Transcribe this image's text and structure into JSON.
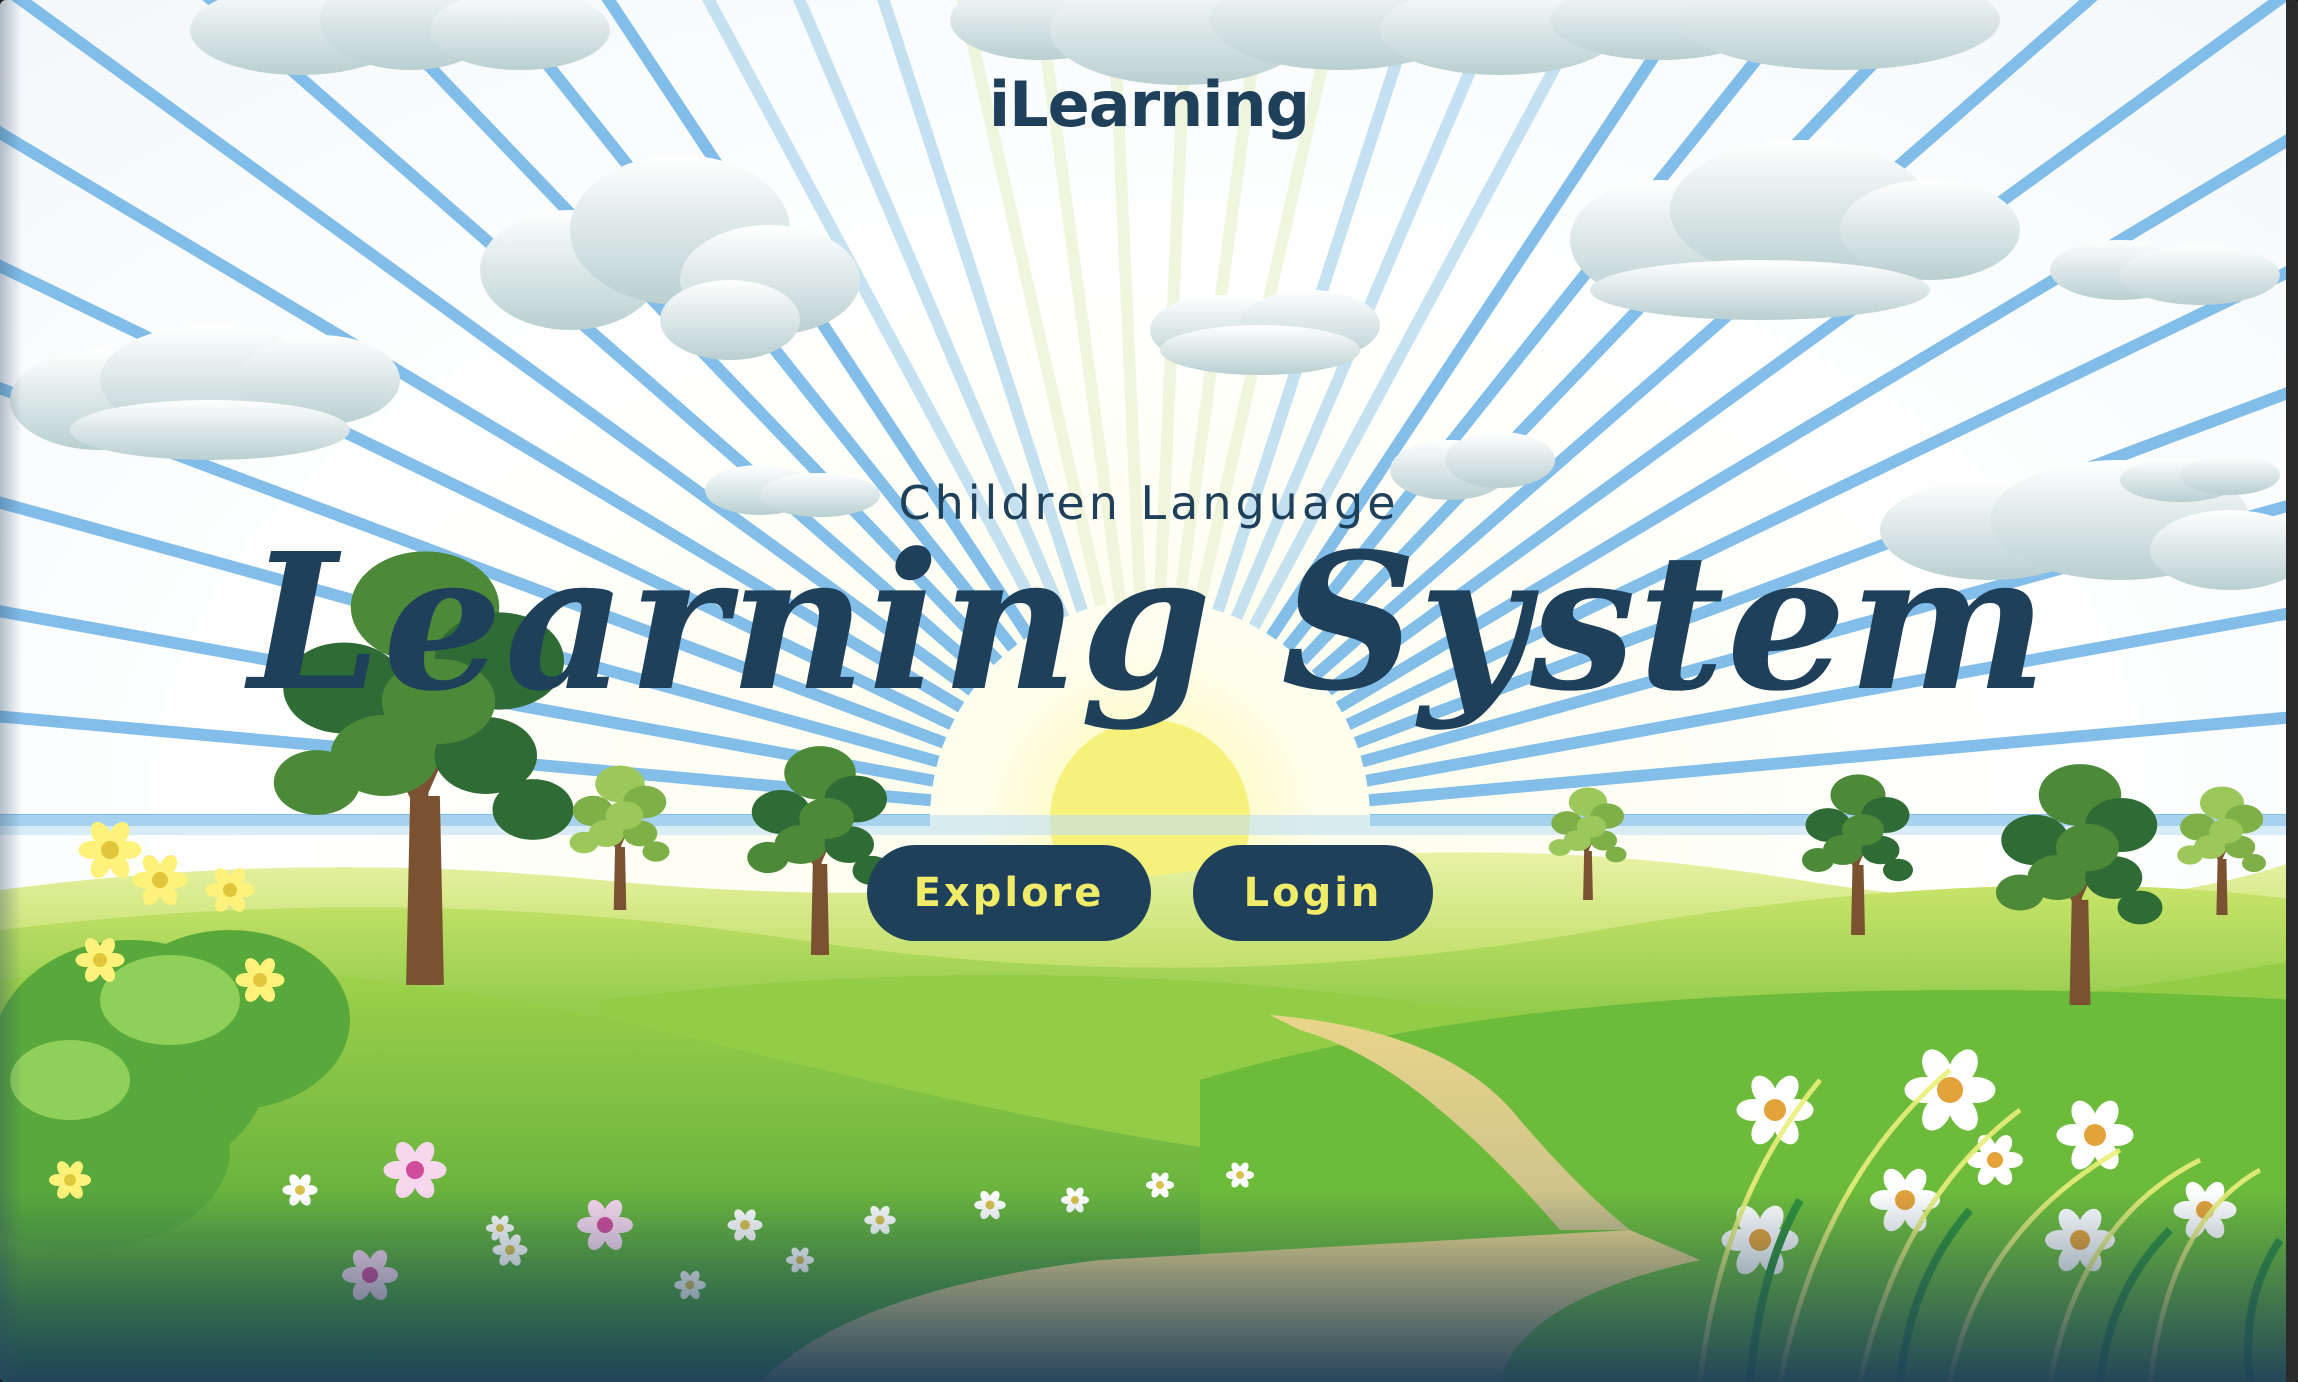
{
  "header": {
    "site_name": "iLearning"
  },
  "hero": {
    "subtitle": "Children Language",
    "title": "Learning System"
  },
  "actions": {
    "explore_label": "Explore",
    "login_label": "Login"
  },
  "colors": {
    "brand_navy": "#1f405a",
    "button_text": "#f0ec6a",
    "sun": "#f5f17a",
    "grass": "#7cc443",
    "sky_ray": "#6db3e6"
  }
}
